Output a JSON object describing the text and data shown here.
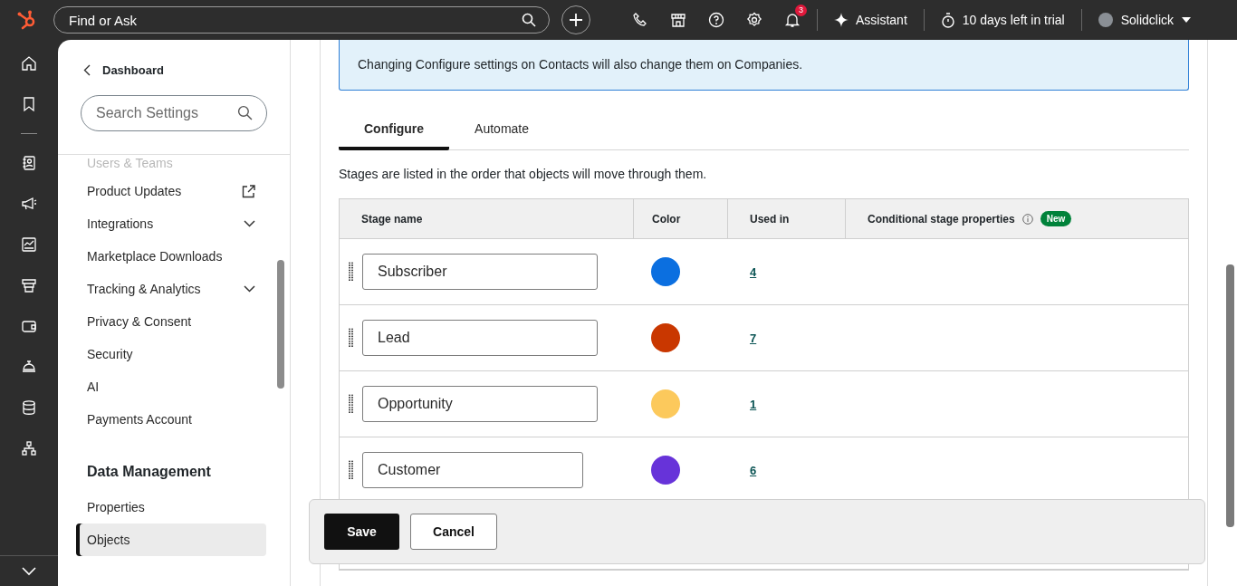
{
  "topbar": {
    "search_placeholder": "Find or Ask",
    "notification_count": "3",
    "assistant": "Assistant",
    "trial": "10 days left in trial",
    "account": "Solidclick"
  },
  "sidebar": {
    "back": "Dashboard",
    "search_placeholder": "Search Settings",
    "items": [
      {
        "label": "Users & Teams",
        "kind": "faded",
        "selected": false
      },
      {
        "label": "Product Updates",
        "kind": "external",
        "selected": false
      },
      {
        "label": "Integrations",
        "kind": "expandable",
        "selected": false
      },
      {
        "label": "Marketplace Downloads",
        "kind": "plain",
        "selected": false
      },
      {
        "label": "Tracking & Analytics",
        "kind": "expandable",
        "selected": false
      },
      {
        "label": "Privacy & Consent",
        "kind": "plain",
        "selected": false
      },
      {
        "label": "Security",
        "kind": "plain",
        "selected": false
      },
      {
        "label": "AI",
        "kind": "plain",
        "selected": false
      },
      {
        "label": "Payments Account",
        "kind": "plain",
        "selected": false
      }
    ],
    "section": "Data Management",
    "section_items": [
      {
        "label": "Properties",
        "selected": false
      },
      {
        "label": "Objects",
        "selected": true
      }
    ]
  },
  "notice": "Changing Configure settings on Contacts will also change them on Companies.",
  "tabs": [
    {
      "label": "Configure",
      "selected": true
    },
    {
      "label": "Automate",
      "selected": false
    }
  ],
  "description": "Stages are listed in the order that objects will move through them.",
  "table": {
    "columns": [
      "Stage name",
      "Color",
      "Used in",
      "Conditional stage properties"
    ],
    "new_badge": "New",
    "rows": [
      {
        "name": "Subscriber",
        "color": "#0b6fe0",
        "used_in": "4"
      },
      {
        "name": "Lead",
        "color": "#c93700",
        "used_in": "7"
      },
      {
        "name": "Opportunity",
        "color": "#fcc95c",
        "used_in": "1"
      },
      {
        "name": "Customer",
        "color": "#6733d9",
        "used_in": "6"
      }
    ]
  },
  "actions": {
    "save": "Save",
    "cancel": "Cancel"
  }
}
